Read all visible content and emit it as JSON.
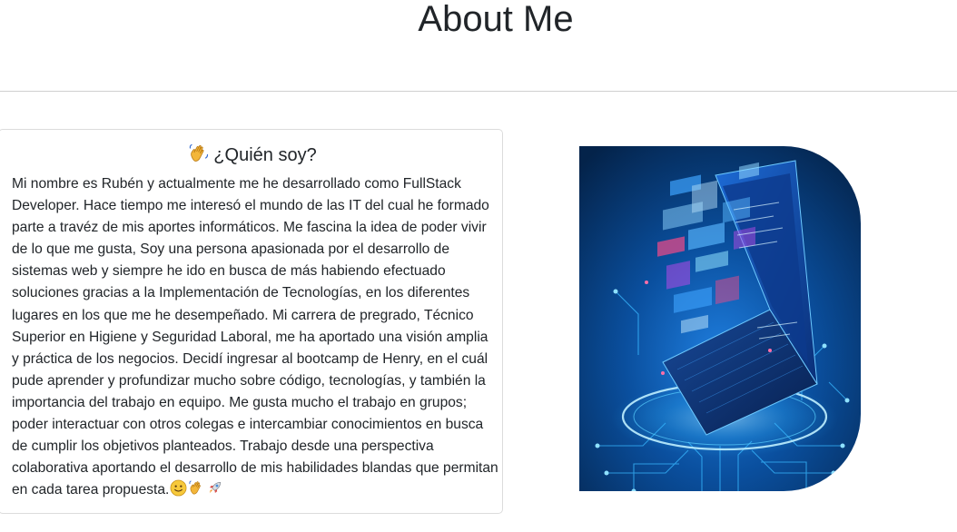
{
  "header": {
    "title": "About Me"
  },
  "about_card": {
    "heading": "¿Quién soy?",
    "heading_icon": "waving-hand-icon",
    "body": "Mi nombre es Rubén y actualmente me he desarrollado como FullStack Developer. Hace tiempo me interesó el mundo de las IT del cual he formado parte a travéz de mis aportes informáticos. Me fascina la idea de poder vivir de lo que me gusta, Soy una persona apasionada por el desarrollo de sistemas web y siempre he ido en busca de más habiendo efectuado soluciones gracias a la Implementación de Tecnologías, en los diferentes lugares en los que me he desempeñado. Mi carrera de pregrado, Técnico Superior en Higiene y Seguridad Laboral, me ha aportado una visión amplia y práctica de los negocios. Decidí ingresar al bootcamp de Henry, en el cuál pude aprender y profundizar mucho sobre código, tecnologías, y también la importancia del trabajo en equipo. Me gusta mucho el trabajo en grupos; poder interactuar con otros colegas e intercambiar conocimientos en busca de cumplir los objetivos planteados. Trabajo desde una perspectiva colaborativa aportando el desarrollo de mis habilidades blandas que permitan en cada tarea propuesta.",
    "trailing_icons": [
      "smiling-face-icon",
      "waving-hand-icon",
      "rocket-icon"
    ]
  },
  "hero": {
    "image_subject": "laptop-with-holographic-data-icon"
  },
  "colors": {
    "text": "#212529",
    "divider": "#cfcfcf",
    "card_border": "#dcdcdc",
    "image_dark": "#04264f",
    "image_glow": "#2fb6ff"
  }
}
